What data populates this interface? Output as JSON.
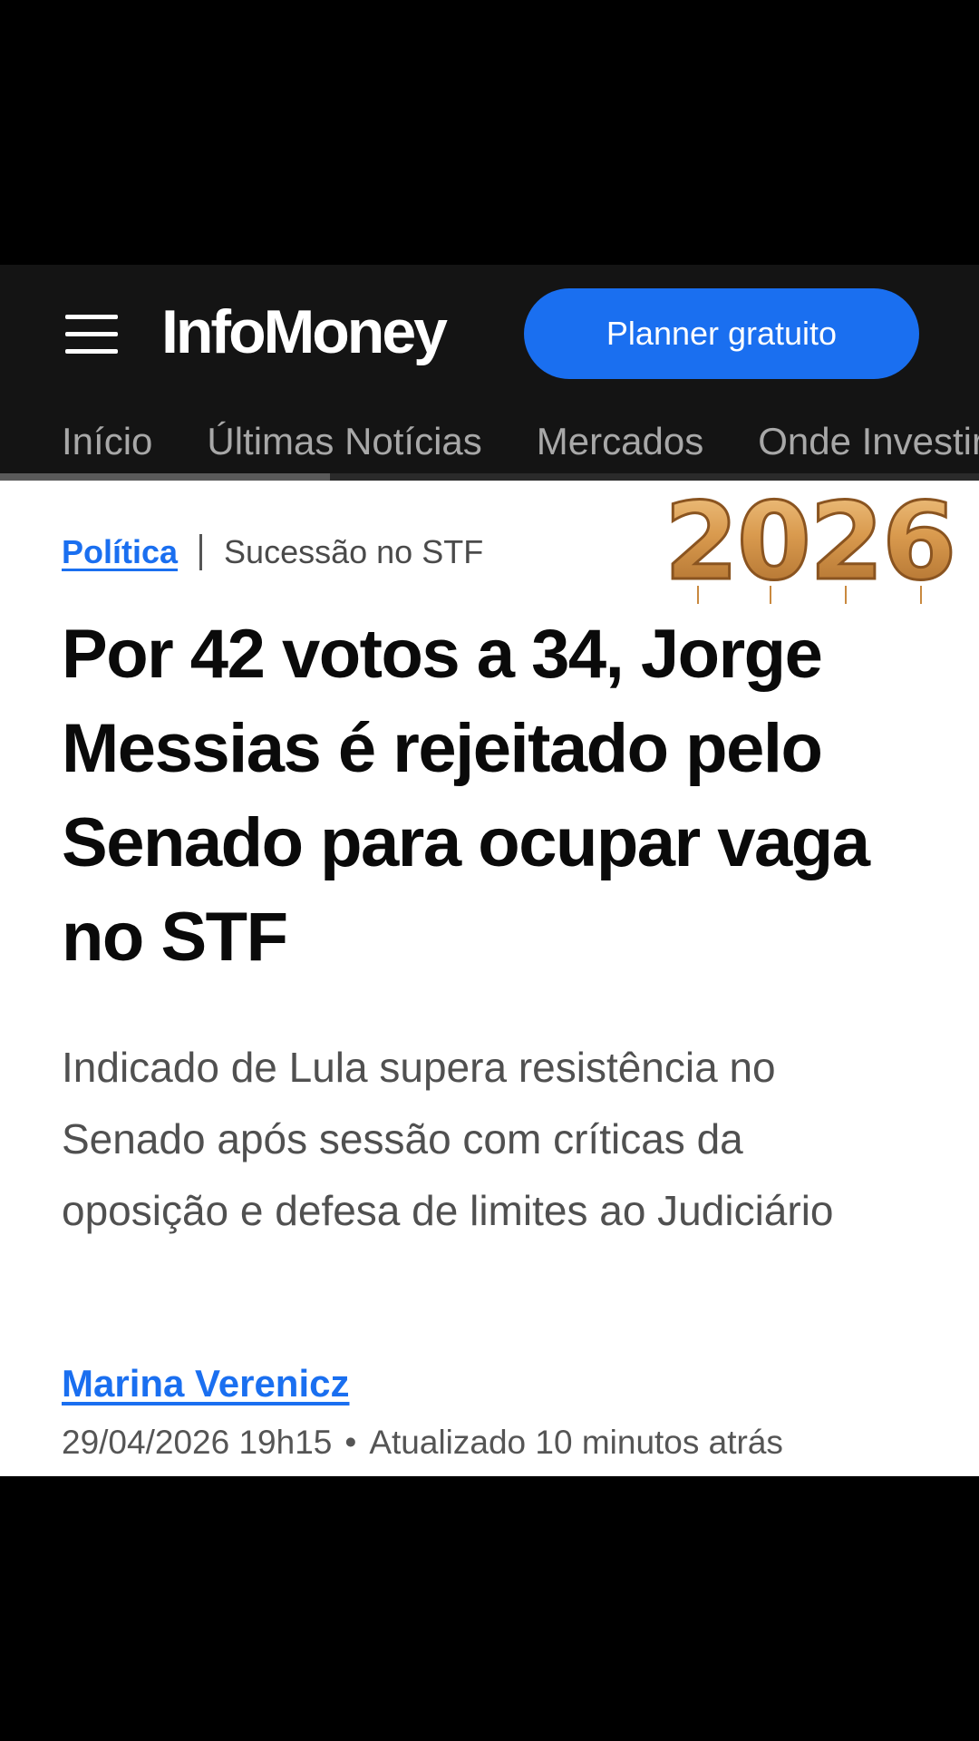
{
  "header": {
    "logo": "InfoMoney",
    "planner_button": "Planner gratuito"
  },
  "nav": {
    "items": [
      "Início",
      "Últimas Notícias",
      "Mercados",
      "Onde Investir"
    ]
  },
  "article": {
    "category": "Política",
    "topic": "Sucessão no STF",
    "overlay_sticker": "2026",
    "headline": "Por 42 votos a 34, Jorge Messias é rejeitado pelo Senado para ocupar vaga no STF",
    "subheadline": "Indicado de Lula supera resistência no Senado após sessão com críticas da oposição e defesa de limites ao Judiciário",
    "author": "Marina Verenicz",
    "published": "29/04/2026 19h15",
    "updated": "Atualizado 10 minutos atrás"
  },
  "colors": {
    "accent_blue": "#1a6ff0",
    "header_bg": "#141414",
    "balloon_gold": "#d99a4e"
  },
  "icons": {
    "menu": "hamburger-menu-icon"
  }
}
